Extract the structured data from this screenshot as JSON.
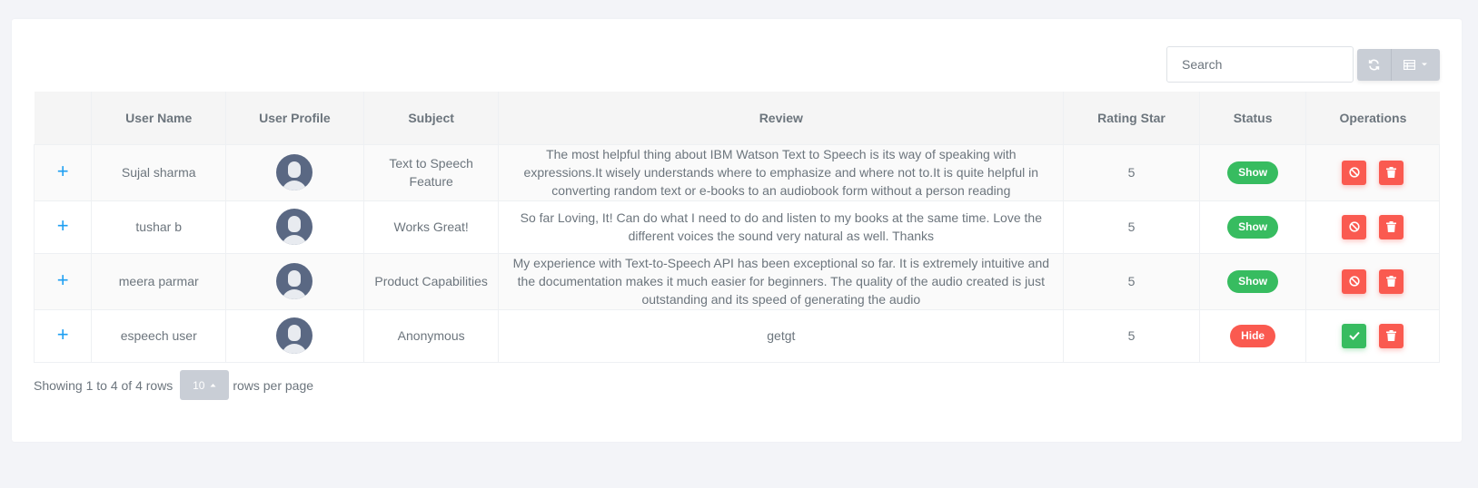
{
  "search": {
    "placeholder": "Search"
  },
  "toolbar": {
    "refresh_icon": "refresh-icon",
    "columns_icon": "columns-icon"
  },
  "table": {
    "headers": [
      "",
      "User Name",
      "User Profile",
      "Subject",
      "Review",
      "Rating Star",
      "Status",
      "Operations"
    ],
    "rows": [
      {
        "user_name": "Sujal sharma",
        "subject": "Text to Speech Feature",
        "review": "The most helpful thing about IBM Watson Text to Speech is its way of speaking with expressions.It wisely understands where to emphasize and where not to.It is quite helpful in converting random text or e-books to an audiobook form without a person reading",
        "rating": "5",
        "status": "Show",
        "status_type": "show"
      },
      {
        "user_name": "tushar b",
        "subject": "Works Great!",
        "review": "So far Loving, It! Can do what I need to do and listen to my books at the same time. Love the different voices the sound very natural as well. Thanks",
        "rating": "5",
        "status": "Show",
        "status_type": "show"
      },
      {
        "user_name": "meera parmar",
        "subject": "Product Capabilities",
        "review": "My experience with Text-to-Speech API has been exceptional so far. It is extremely intuitive and the documentation makes it much easier for beginners. The quality of the audio created is just outstanding and its speed of generating the audio",
        "rating": "5",
        "status": "Show",
        "status_type": "show"
      },
      {
        "user_name": "espeech user",
        "subject": "Anonymous",
        "review": "getgt",
        "rating": "5",
        "status": "Hide",
        "status_type": "hide"
      }
    ]
  },
  "pagination": {
    "summary": "Showing 1 to 4 of 4 rows",
    "page_size": "10",
    "suffix": "rows per page"
  },
  "colors": {
    "accent_blue": "#1e9ff2",
    "show_green": "#37bc60",
    "hide_red": "#fa5a50"
  }
}
